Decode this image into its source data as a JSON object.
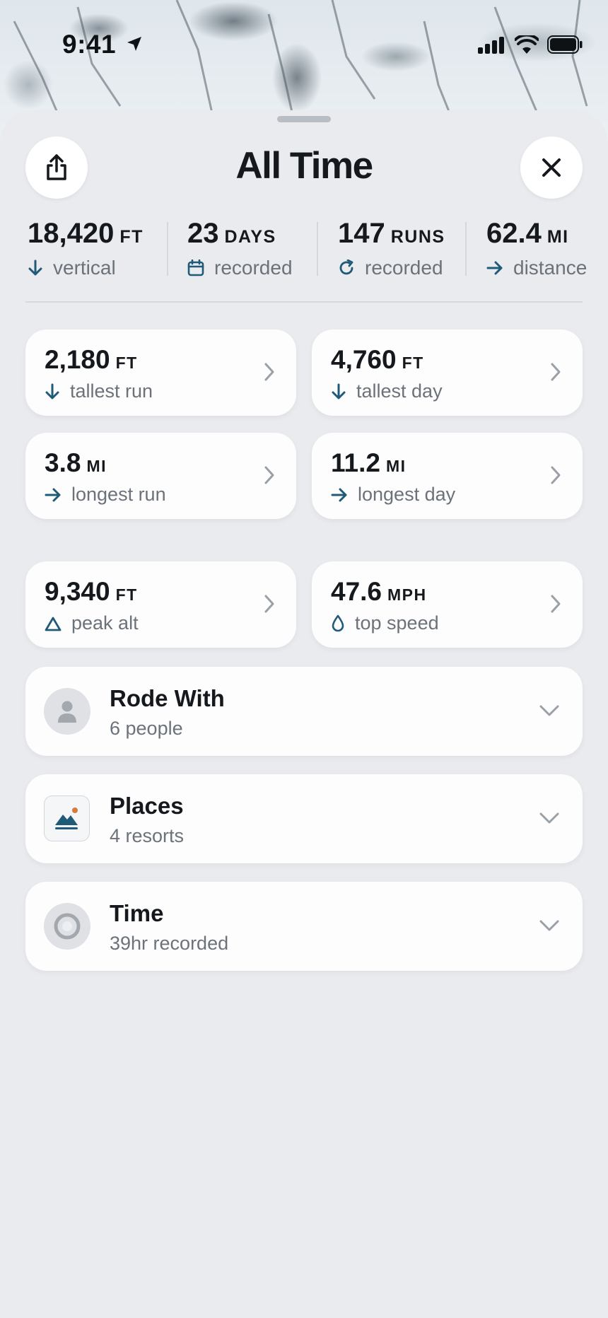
{
  "status_bar": {
    "time": "9:41"
  },
  "header": {
    "title": "All Time"
  },
  "colors": {
    "accent": "#1f5a78",
    "muted": "#6c727a",
    "orange": "#d77a3c"
  },
  "summary": [
    {
      "value": "18,420",
      "unit": "FT",
      "label": "vertical",
      "icon": "arrow-down-icon"
    },
    {
      "value": "23",
      "unit": "DAYS",
      "label": "recorded",
      "icon": "calendar-icon"
    },
    {
      "value": "147",
      "unit": "RUNS",
      "label": "recorded",
      "icon": "refresh-icon"
    },
    {
      "value": "62.4",
      "unit": "MI",
      "label": "distance",
      "icon": "arrow-right-icon"
    }
  ],
  "records": [
    {
      "value": "2,180",
      "unit": "FT",
      "label": "tallest run",
      "icon": "arrow-down-icon"
    },
    {
      "value": "4,760",
      "unit": "FT",
      "label": "tallest day",
      "icon": "arrow-down-icon"
    },
    {
      "value": "3.8",
      "unit": "MI",
      "label": "longest run",
      "icon": "arrow-right-icon"
    },
    {
      "value": "11.2",
      "unit": "MI",
      "label": "longest day",
      "icon": "arrow-right-icon"
    }
  ],
  "peaks": [
    {
      "value": "9,340",
      "unit": "FT",
      "label": "peak alt",
      "icon": "triangle-icon"
    },
    {
      "value": "47.6",
      "unit": "MPH",
      "label": "top speed",
      "icon": "drop-icon"
    }
  ],
  "rows": [
    {
      "title": "Rode With",
      "subtitle": "6 people",
      "icon": "person-icon"
    },
    {
      "title": "Places",
      "subtitle": "4 resorts",
      "icon": "mountain-icon"
    },
    {
      "title": "Time",
      "subtitle": "39hr recorded",
      "icon": "clock-icon"
    }
  ]
}
